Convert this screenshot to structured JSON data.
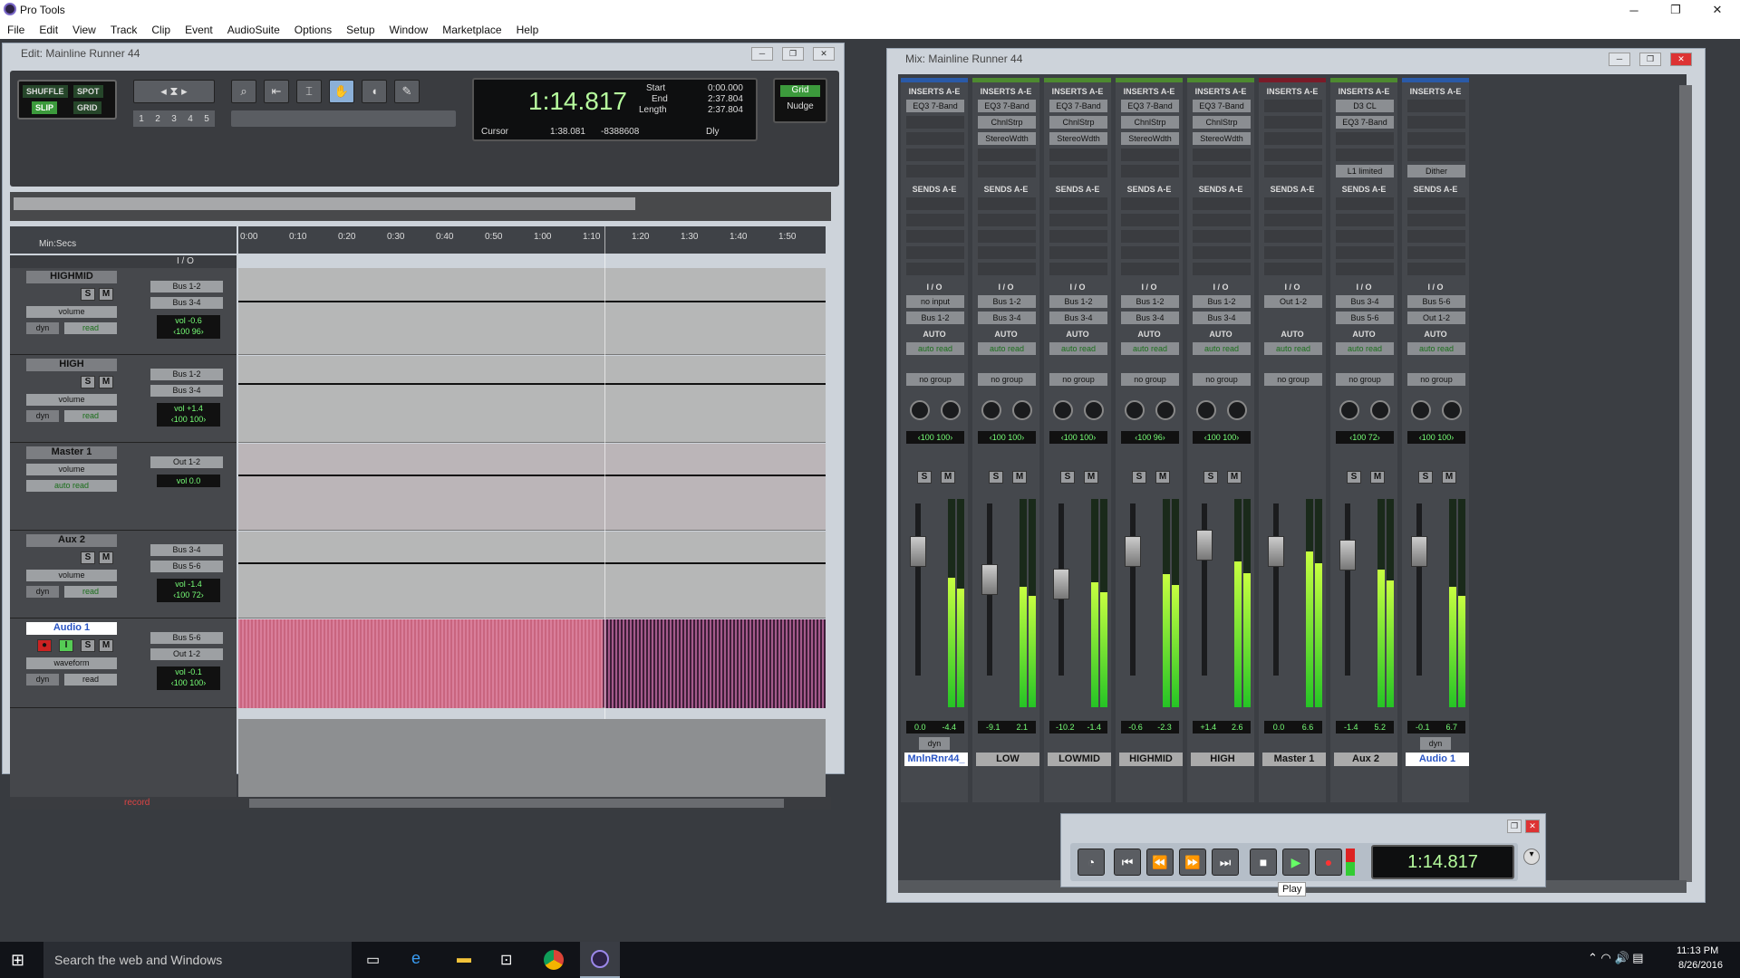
{
  "app": {
    "title": "Pro Tools"
  },
  "menu": [
    "File",
    "Edit",
    "View",
    "Track",
    "Clip",
    "Event",
    "AudioSuite",
    "Options",
    "Setup",
    "Window",
    "Marketplace",
    "Help"
  ],
  "edit_window": {
    "title": "Edit: Mainline Runner 44",
    "modes": [
      "SHUFFLE",
      "SPOT",
      "SLIP",
      "GRID"
    ],
    "counter": {
      "main": "1:14.817",
      "start_label": "Start",
      "start": "0:00.000",
      "end_label": "End",
      "end": "2:37.804",
      "length_label": "Length",
      "length": "2:37.804",
      "cursor_label": "Cursor",
      "cursor": "1:38.081",
      "offset": "-8388608",
      "dly": "Dly"
    },
    "grid_label": "Grid",
    "nudge_label": "Nudge",
    "numbers": [
      "1",
      "2",
      "3",
      "4",
      "5"
    ],
    "ruler_label": "Min:Secs",
    "ruler_ticks": [
      "0:00",
      "0:10",
      "0:20",
      "0:30",
      "0:40",
      "0:50",
      "1:00",
      "1:10",
      "1:20",
      "1:30",
      "1:40",
      "1:50"
    ],
    "io_header": "I / O",
    "tracks": [
      {
        "name": "HIGHMID",
        "view": "volume",
        "mode": "read",
        "dyn": "dyn",
        "io": [
          "Bus 1-2",
          "Bus 3-4"
        ],
        "vol": "vol",
        "vol_val": "-0.6",
        "pan_l": "‹100",
        "pan_r": "96›"
      },
      {
        "name": "HIGH",
        "view": "volume",
        "mode": "read",
        "dyn": "dyn",
        "io": [
          "Bus 1-2",
          "Bus 3-4"
        ],
        "vol": "vol",
        "vol_val": "+1.4",
        "pan_l": "‹100",
        "pan_r": "100›"
      },
      {
        "name": "Master 1",
        "view": "volume",
        "mode": "auto read",
        "dyn": "",
        "io": [
          "Out 1-2",
          ""
        ],
        "vol": "vol",
        "vol_val": "0.0",
        "pan_l": "",
        "pan_r": ""
      },
      {
        "name": "Aux 2",
        "view": "volume",
        "mode": "read",
        "dyn": "dyn",
        "io": [
          "Bus 3-4",
          "Bus 5-6"
        ],
        "vol": "vol",
        "vol_val": "-1.4",
        "pan_l": "‹100",
        "pan_r": "72›"
      },
      {
        "name": "Audio 1",
        "view": "waveform",
        "mode": "read",
        "dyn": "dyn",
        "io": [
          "Bus 5-6",
          "Out 1-2"
        ],
        "vol": "vol",
        "vol_val": "-0.1",
        "pan_l": "‹100",
        "pan_r": "100›"
      }
    ],
    "record_label": "record"
  },
  "mix_window": {
    "title": "Mix: Mainline Runner 44",
    "inserts_label": "INSERTS A-E",
    "sends_label": "SENDS A-E",
    "io_label": "I / O",
    "auto_label": "AUTO",
    "channels": [
      {
        "name": "MnlnRnr44_",
        "inserts": [
          "EQ3 7-Band"
        ],
        "io": [
          "no input",
          "Bus 1-2"
        ],
        "auto": "auto read",
        "group": "no group",
        "pan_l": "‹100",
        "pan_r": "100›",
        "vol_l": "0.0",
        "vol_r": "-4.4",
        "dyn": "dyn",
        "fader": 0.72,
        "meter": 0.62,
        "color": "#2a5aa8"
      },
      {
        "name": "LOW",
        "inserts": [
          "EQ3 7-Band",
          "ChnlStrp",
          "StereoWdth"
        ],
        "io": [
          "Bus 1-2",
          "Bus 3-4"
        ],
        "auto": "auto read",
        "group": "no group",
        "pan_l": "‹100",
        "pan_r": "100›",
        "vol_l": "-9.1",
        "vol_r": "2.1",
        "dyn": "",
        "fader": 0.56,
        "meter": 0.58,
        "color": "#4d8a30"
      },
      {
        "name": "LOWMID",
        "inserts": [
          "EQ3 7-Band",
          "ChnlStrp",
          "StereoWdth"
        ],
        "io": [
          "Bus 1-2",
          "Bus 3-4"
        ],
        "auto": "auto read",
        "group": "no group",
        "pan_l": "‹100",
        "pan_r": "100›",
        "vol_l": "-10.2",
        "vol_r": "-1.4",
        "dyn": "",
        "fader": 0.53,
        "meter": 0.6,
        "color": "#4d8a30"
      },
      {
        "name": "HIGHMID",
        "inserts": [
          "EQ3 7-Band",
          "ChnlStrp",
          "StereoWdth"
        ],
        "io": [
          "Bus 1-2",
          "Bus 3-4"
        ],
        "auto": "auto read",
        "group": "no group",
        "pan_l": "‹100",
        "pan_r": "96›",
        "vol_l": "-0.6",
        "vol_r": "-2.3",
        "dyn": "",
        "fader": 0.72,
        "meter": 0.64,
        "color": "#4d8a30"
      },
      {
        "name": "HIGH",
        "inserts": [
          "EQ3 7-Band",
          "ChnlStrp",
          "StereoWdth"
        ],
        "io": [
          "Bus 1-2",
          "Bus 3-4"
        ],
        "auto": "auto read",
        "group": "no group",
        "pan_l": "‹100",
        "pan_r": "100›",
        "vol_l": "+1.4",
        "vol_r": "2.6",
        "dyn": "",
        "fader": 0.76,
        "meter": 0.7,
        "color": "#4d8a30"
      },
      {
        "name": "Master 1",
        "inserts": [],
        "io": [
          "Out 1-2",
          ""
        ],
        "auto": "auto read",
        "group": "no group",
        "pan_l": "",
        "pan_r": "",
        "vol_l": "0.0",
        "vol_r": "6.6",
        "dyn": "",
        "fader": 0.72,
        "meter": 0.75,
        "color": "#7a1b28"
      },
      {
        "name": "Aux 2",
        "inserts": [
          "D3 CL",
          "EQ3 7-Band",
          "",
          "",
          "L1 limited"
        ],
        "io": [
          "Bus 3-4",
          "Bus 5-6"
        ],
        "auto": "auto read",
        "group": "no group",
        "pan_l": "‹100",
        "pan_r": "72›",
        "vol_l": "-1.4",
        "vol_r": "5.2",
        "dyn": "",
        "fader": 0.7,
        "meter": 0.66,
        "color": "#4d8a30"
      },
      {
        "name": "Audio 1",
        "inserts": [
          "",
          "",
          "",
          "",
          "Dither"
        ],
        "io": [
          "Bus 5-6",
          "Out 1-2"
        ],
        "auto": "auto read",
        "group": "no group",
        "pan_l": "‹100",
        "pan_r": "100›",
        "vol_l": "-0.1",
        "vol_r": "6.7",
        "dyn": "dyn",
        "fader": 0.72,
        "meter": 0.58,
        "color": "#2a5aa8"
      }
    ]
  },
  "transport": {
    "counter": "1:14.817",
    "tooltip": "Play"
  },
  "taskbar": {
    "search_placeholder": "Search the web and Windows",
    "time": "11:13 PM",
    "date": "8/26/2016"
  }
}
